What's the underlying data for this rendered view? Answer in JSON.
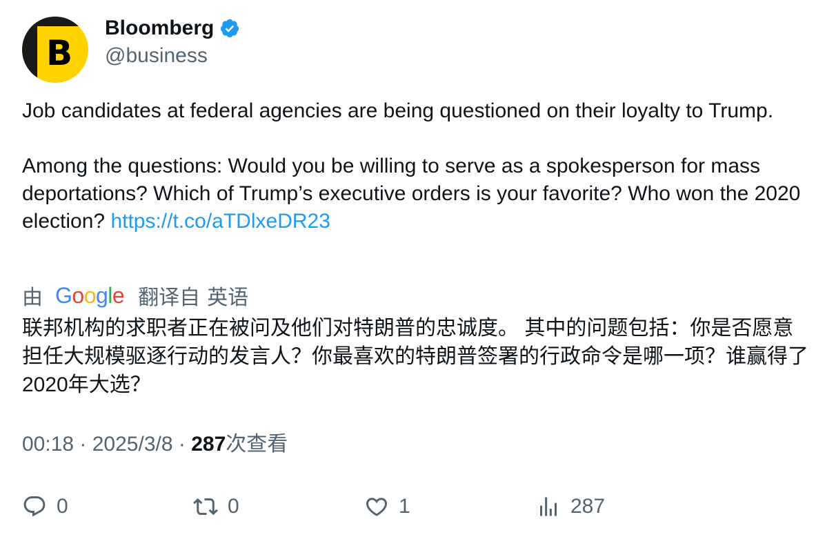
{
  "author": {
    "avatar_letter": "B",
    "display_name": "Bloomberg",
    "handle": "@business",
    "verified_icon": "verified-badge-icon"
  },
  "tweet": {
    "paragraph1": "Job candidates at federal agencies are being questioned on their loyalty to Trump.",
    "paragraph2": "Among the questions: Would you be willing to serve as a spokesperson for mass deportations? Which of Trump’s executive orders is your favorite? Who won the 2020 election? ",
    "link": "https://t.co/aTDlxeDR23"
  },
  "translation": {
    "by_label": "由",
    "provider": "Google",
    "from_label": "翻译自",
    "language": "英语",
    "text": "联邦机构的求职者正在被问及他们对特朗普的忠诚度。 其中的问题包括：你是否愿意担任大规模驱逐行动的发言人？你最喜欢的特朗普签署的行政命令是哪一项？谁赢得了2020年大选？"
  },
  "meta": {
    "time": "00:18",
    "dot1": " · ",
    "date": "2025/3/8",
    "dot2": " · ",
    "views_count": "287",
    "views_label": "次查看"
  },
  "actions": {
    "reply": {
      "icon": "reply-icon",
      "count": "0"
    },
    "retweet": {
      "icon": "retweet-icon",
      "count": "0"
    },
    "like": {
      "icon": "heart-icon",
      "count": "1"
    },
    "views": {
      "icon": "analytics-icon",
      "count": "287"
    }
  },
  "colors": {
    "accent": "#1d9bf0",
    "text": "#0f1419",
    "secondary": "#536471",
    "avatar_bg": "#ffd300"
  }
}
